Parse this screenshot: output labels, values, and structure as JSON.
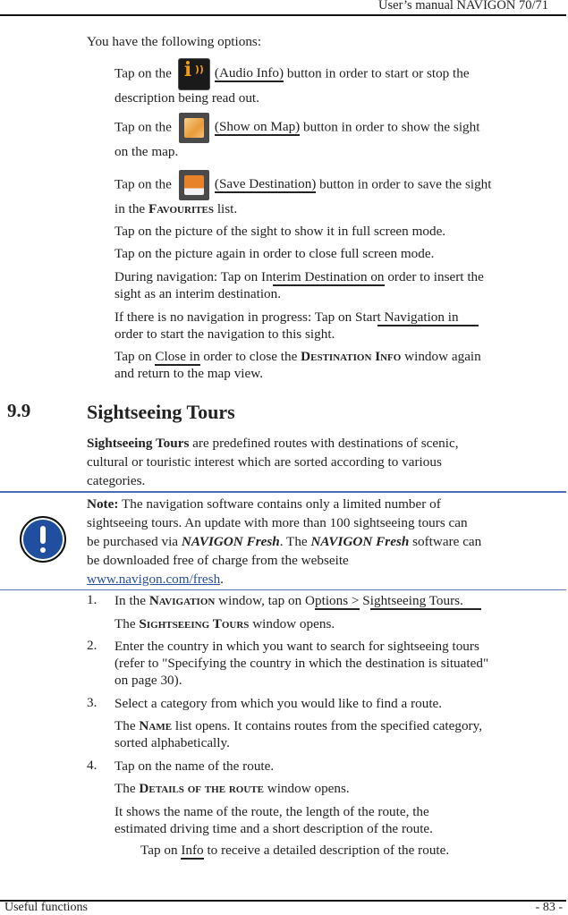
{
  "header": {
    "title": "User’s manual NAVIGON 70/71"
  },
  "intro": "You have the following options:",
  "options": [
    {
      "pre": "Tap on the",
      "icon": "audio-info-icon",
      "link": "(Audio Info)",
      "post": " button in order to start or stop the",
      "line2": "description being read out."
    },
    {
      "pre": "Tap on the",
      "icon": "show-on-map-icon",
      "link": "(Show on Map)",
      "post": " button in order to show the sight",
      "line2": "on the map."
    },
    {
      "pre": "Tap on the",
      "icon": "save-destination-icon",
      "link": "(Save Destination)",
      "post": " button in order to save the sight",
      "line2_pre": "in the ",
      "line2_sc": "Favourites",
      "line2_post": " list."
    }
  ],
  "lines": {
    "fullscreen": "Tap on the picture of the sight to show it in full screen mode.",
    "close_fullscreen": "Tap on the picture again in order to close full screen mode.",
    "interim_pre": "During navigation: Tap on In",
    "interim_link": "terim Destination on",
    "interim_post": " order to insert the",
    "interim_line2": "sight as an interim destination.",
    "start_pre": "If there is no navigation in progress: Tap on Star",
    "start_link": "t Navigation in",
    "start_line2": "order to start the navigation to this sight.",
    "close_pre": "Tap on ",
    "close_link": "Close in",
    "close_mid": " order to close the ",
    "close_sc": "Destination Info",
    "close_post": " window again",
    "close_line2": "and return to the map view."
  },
  "section": {
    "number": "9.9",
    "title": "Sightseeing Tours",
    "intro_bold": "Sightseeing Tours",
    "intro_rest1": " are predefined routes with destinations of scenic,",
    "intro_line2": "cultural or touristic interest which are sorted according to various",
    "intro_line3": "categories."
  },
  "note": {
    "label": "Note:",
    "line1": " The navigation software contains only a limited number of",
    "line2": "sightseeing tours. An update with more than 100 sightseeing tours can",
    "line3_pre": "be purchased via ",
    "brand": "NAVIGON Fresh",
    "line3_mid": ". The ",
    "line3_post": " software can",
    "line4": "be downloaded free of charge from the webseite",
    "url": "www.navigon.com/fresh",
    "url_after": "."
  },
  "steps": [
    {
      "num": "1.",
      "pre": "In the ",
      "sc": "Navigation",
      "mid": " window, tap on O",
      "link1": "ptions >",
      "sep": " S",
      "link2": "ightseeing Tours.",
      "sub_pre": "The ",
      "sub_sc": "Sightseeing Tours",
      "sub_post": " window opens."
    },
    {
      "num": "2.",
      "line1": "Enter the country in which you want to search for sightseeing tours",
      "line2": "(refer to \"Specifying the country in which the destination is situated\"",
      "line3": "on page 30)."
    },
    {
      "num": "3.",
      "line1": "Select a category from which you would like to find a route.",
      "sub_pre": "The ",
      "sub_sc": "Name",
      "sub_post": " list opens. It contains routes from the specified category,",
      "sub_line2": "sorted alphabetically."
    },
    {
      "num": "4.",
      "line1": "Tap on the name of the route.",
      "sub_pre": "The ",
      "sub_sc": "Details of the route",
      "sub_post": " window opens.",
      "desc1": "It shows the name of the route, the length of the route, the",
      "desc2": "estimated driving time and a short description of the route.",
      "info_pre": "Tap on ",
      "info_link": "Info",
      "info_post": " to receive a detailed description of the route."
    }
  ],
  "footer": {
    "left": "Useful functions",
    "right": "- 83 -"
  }
}
